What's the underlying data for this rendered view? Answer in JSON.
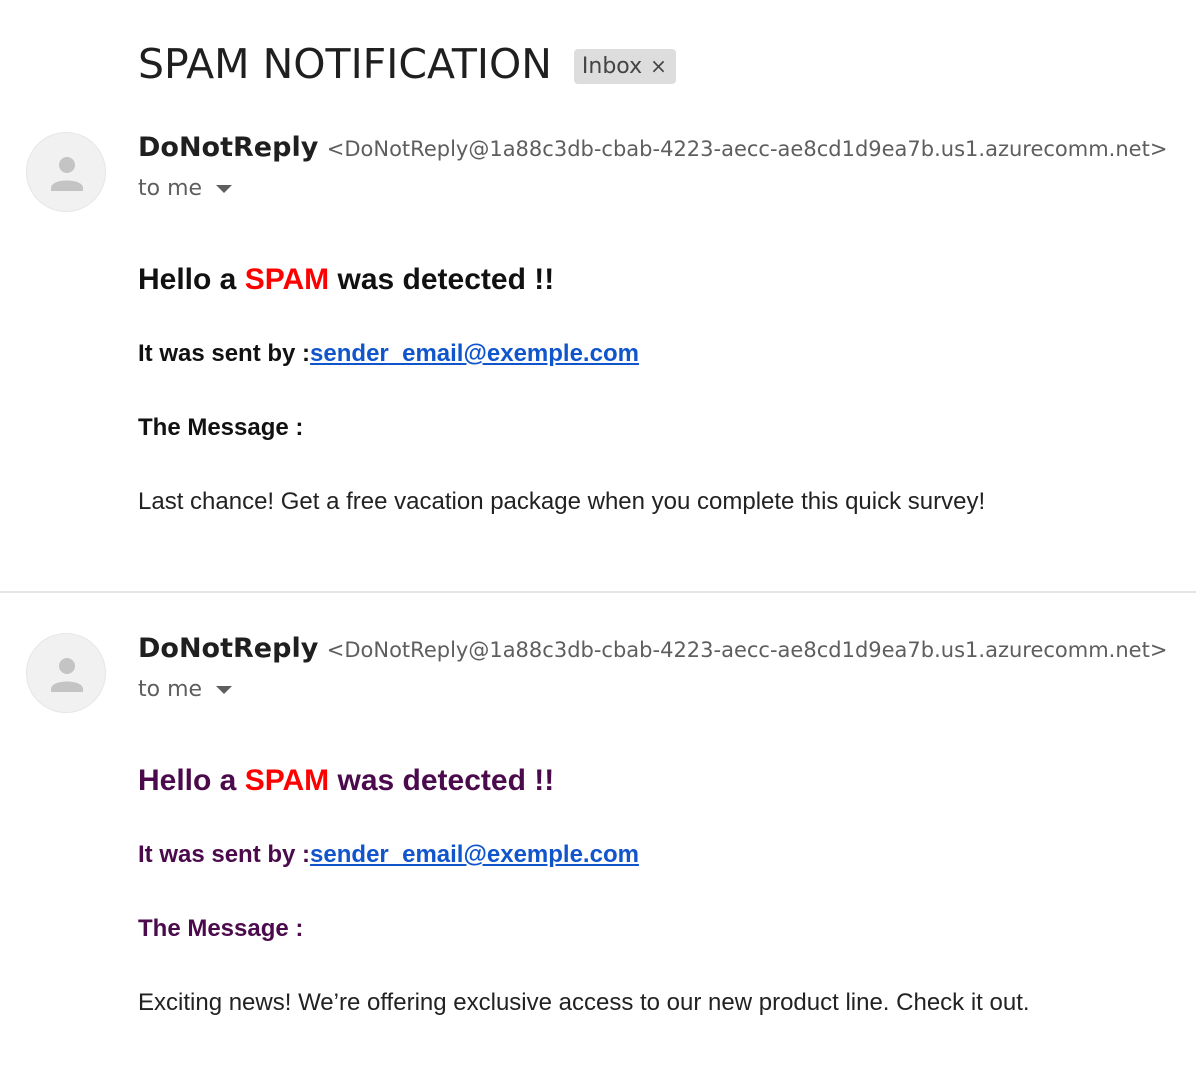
{
  "subject": "SPAM NOTIFICATION",
  "label_chip": {
    "text": "Inbox",
    "close_glyph": "×"
  },
  "colors": {
    "spam_word": "#ff0000",
    "link": "#1155cc",
    "read_heading": "#4b0a4b"
  },
  "messages": [
    {
      "sender_name": "DoNotReply",
      "sender_email": "<DoNotReply@1a88c3db-cbab-4223-aecc-ae8cd1d9ea7b.us1.azurecomm.net>",
      "to_label": "to me",
      "heading_prefix": "Hello a ",
      "heading_spam": "SPAM",
      "heading_suffix": " was detected !!",
      "sent_by_label": "It was sent by :",
      "sent_by_email": "sender_email@exemple.com",
      "message_label": "The Message :",
      "message_text": "Last chance! Get a free vacation package when you complete this quick survey!"
    },
    {
      "sender_name": "DoNotReply",
      "sender_email": "<DoNotReply@1a88c3db-cbab-4223-aecc-ae8cd1d9ea7b.us1.azurecomm.net>",
      "to_label": "to me",
      "heading_prefix": "Hello a ",
      "heading_spam": "SPAM",
      "heading_suffix": " was detected !!",
      "sent_by_label": "It was sent by :",
      "sent_by_email": "sender_email@exemple.com",
      "message_label": "The Message :",
      "message_text": "Exciting news! We’re offering exclusive access to our new product line. Check it out."
    }
  ]
}
